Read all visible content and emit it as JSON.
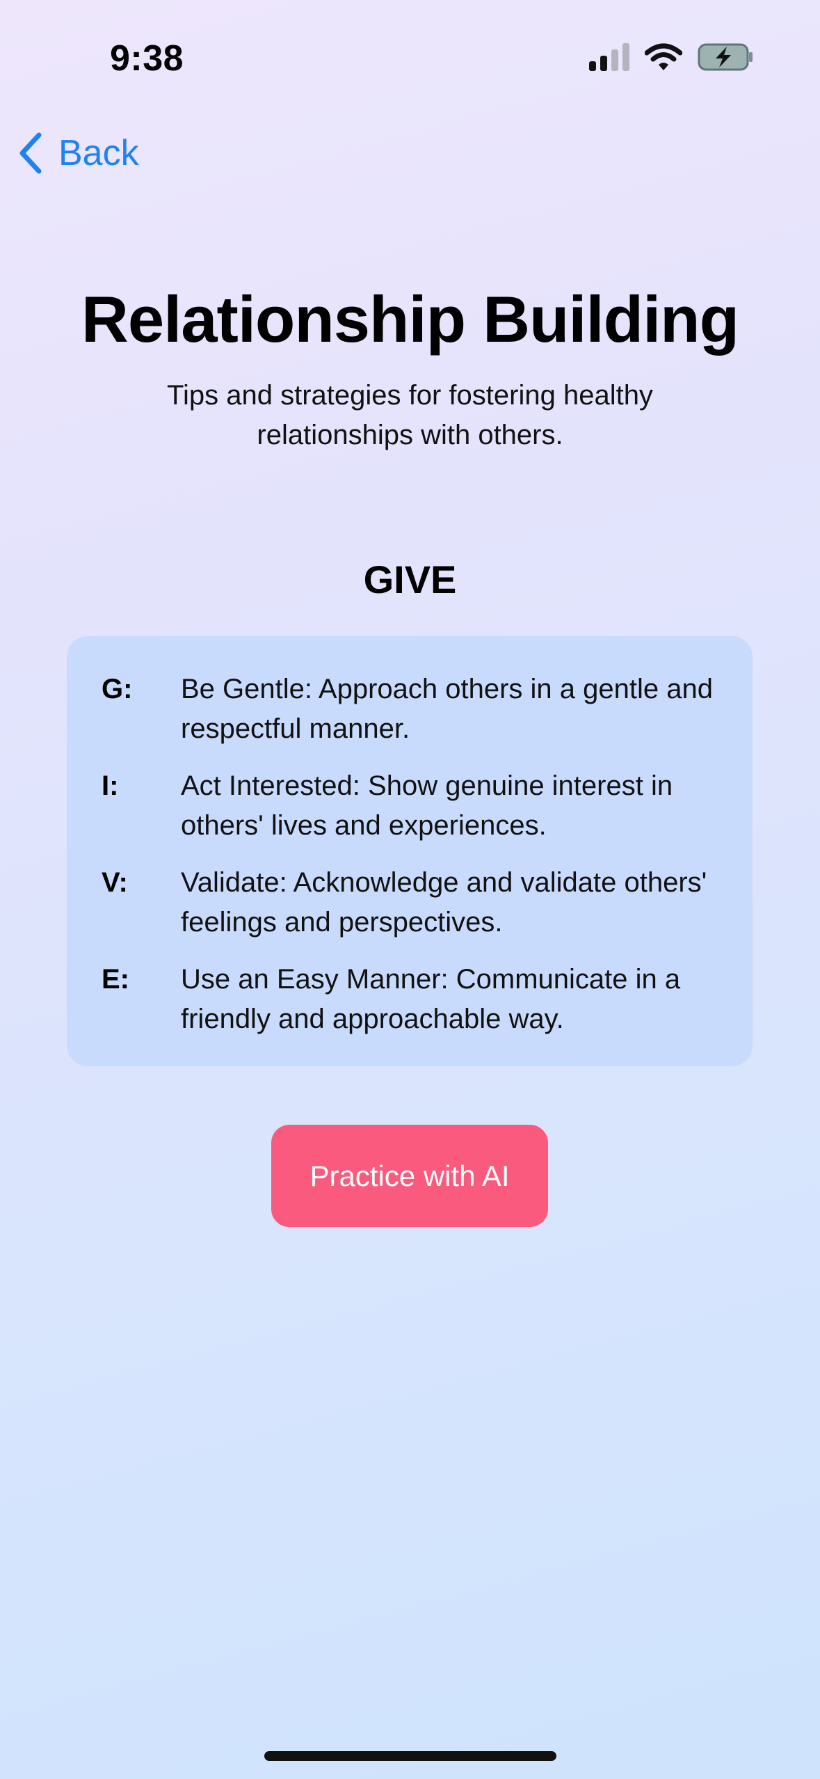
{
  "status_bar": {
    "time": "9:38",
    "icons": [
      "signal-icon",
      "wifi-icon",
      "battery-charging-icon"
    ]
  },
  "nav": {
    "back_label": "Back",
    "back_icon": "chevron-left-icon"
  },
  "header": {
    "title": "Relationship Building",
    "subtitle": "Tips and strategies for fostering healthy relationships with others."
  },
  "give": {
    "heading": "GIVE",
    "items": [
      {
        "letter": "G:",
        "text": "Be Gentle: Approach others in a gentle and respectful manner."
      },
      {
        "letter": "I:",
        "text": "Act Interested: Show genuine interest in others' lives and experiences."
      },
      {
        "letter": "V:",
        "text": "Validate: Acknowledge and validate others' feelings and perspectives."
      },
      {
        "letter": "E:",
        "text": "Use an Easy Manner: Communicate in a friendly and approachable way."
      }
    ]
  },
  "actions": {
    "practice_label": "Practice with AI"
  },
  "colors": {
    "accent": "#1e82f0",
    "button": "#fa5a7e",
    "card": "#c9dbfd"
  }
}
